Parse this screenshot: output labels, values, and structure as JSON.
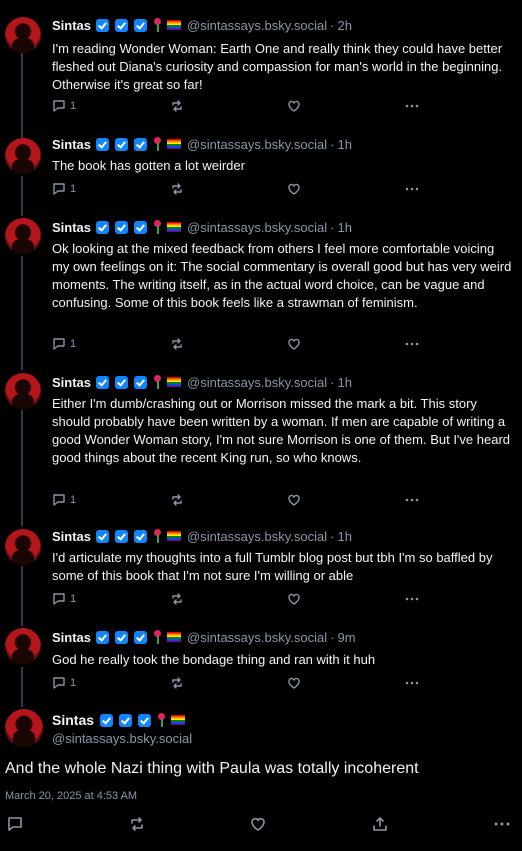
{
  "author": {
    "name": "Sintas",
    "handle": "@sintassays.bsky.social"
  },
  "thread_posts": [
    {
      "time": "2h",
      "text": "I'm reading Wonder Woman: Earth One and really think they could have better fleshed out Diana's curiosity and compassion for man's world in the beginning. Otherwise it's great so far!",
      "reply_count": "1"
    },
    {
      "time": "1h",
      "text": "The book has gotten a lot weirder",
      "reply_count": "1"
    },
    {
      "time": "1h",
      "text": "Ok looking at the mixed feedback from others I feel more comfortable voicing my own feelings on it: The social commentary is overall good but has very weird moments. The writing itself, as in the actual word choice, can be vague and confusing. Some of this book feels like a strawman of feminism.",
      "reply_count": "1"
    },
    {
      "time": "1h",
      "text": "Either I'm dumb/crashing out or Morrison missed the mark a bit. This story should probably have been written by a woman. If men are capable of writing a good Wonder Woman story, I'm not sure Morrison is one of them. But I've heard good things about the recent King run, so who knows.",
      "reply_count": "1"
    },
    {
      "time": "1h",
      "text": "I'd articulate my thoughts into a full Tumblr blog post but tbh I'm so baffled by some of this book that I'm not sure I'm willing or able",
      "reply_count": "1"
    },
    {
      "time": "9m",
      "text": "God he really took the bondage thing and ran with it huh",
      "reply_count": "1"
    }
  ],
  "main_post": {
    "text": "And the whole Nazi thing with Paula was totally incoherent",
    "date": "March 20, 2025 at 4:53 AM"
  },
  "icons": {
    "reply": "speech-bubble-icon",
    "repost": "repost-arrows-icon",
    "like": "heart-icon",
    "share": "share-upload-icon",
    "more": "ellipsis-icon",
    "verified": "blue-check-badge-icon",
    "rose": "rose-emoji-icon",
    "pride_flag": "rainbow-flag-icon"
  },
  "colors": {
    "background": "#000000",
    "text": "#f1f3f5",
    "muted": "#8a96a5",
    "badge": "#1185fe",
    "thread_line": "#2e3a47"
  }
}
